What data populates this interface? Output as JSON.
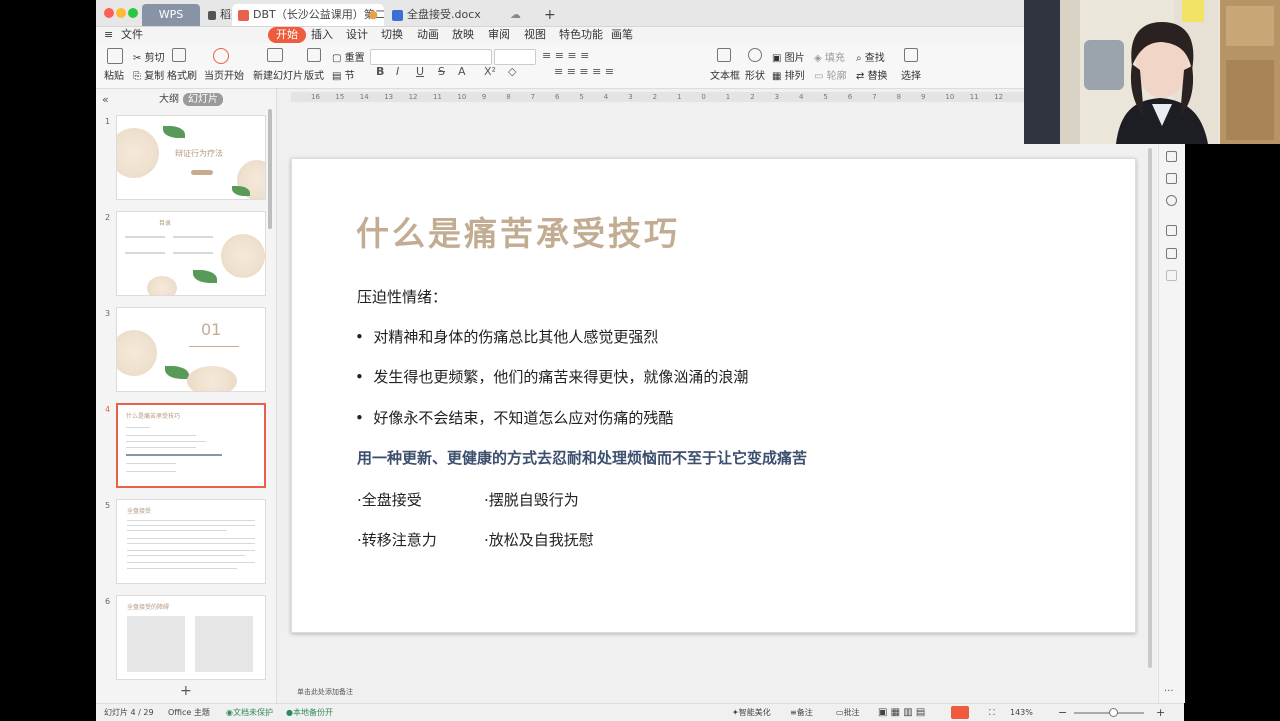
{
  "tabs": {
    "wps": "WPS",
    "daoke": "稻壳",
    "dbt": "DBT（长沙公益课用）第二课",
    "docx": "全盘接受.docx"
  },
  "menu": [
    "文件",
    "开始",
    "插入",
    "设计",
    "切换",
    "动画",
    "放映",
    "审阅",
    "视图",
    "特色功能",
    "画笔"
  ],
  "ribbon": {
    "paste": "粘贴",
    "cut": "剪切",
    "copy": "复制",
    "format_painter": "格式刷",
    "from_current": "当页开始",
    "new_slide": "新建幻灯片",
    "layout": "版式",
    "section": "节",
    "reset": "重置",
    "textbox": "文本框",
    "shape": "形状",
    "picture": "图片",
    "arrange": "排列",
    "fill": "填充",
    "outline": "轮廓",
    "find": "查找",
    "replace": "替换",
    "select": "选择"
  },
  "left_panel": {
    "outline_tab": "大纲",
    "slides_tab": "幻灯片",
    "thumbs": [
      {
        "num": "1",
        "title": "辩证行为疗法"
      },
      {
        "num": "2",
        "title": "目录"
      },
      {
        "num": "3",
        "title": "01"
      },
      {
        "num": "4",
        "title": "什么是痛苦承受技巧"
      },
      {
        "num": "5",
        "title": "全盘接受"
      },
      {
        "num": "6",
        "title": "全盘接受的障碍"
      }
    ],
    "add": "+"
  },
  "slide": {
    "title": "什么是痛苦承受技巧",
    "subtitle": "压迫性情绪：",
    "bullets": [
      "对精神和身体的伤痛总比其他人感觉更强烈",
      "发生得也更频繁，他们的痛苦来得更快，就像汹涌的浪潮",
      "好像永不会结束，不知道怎么应对伤痛的残酷"
    ],
    "highlight": "用一种更新、更健康的方式去忍耐和处理烦恼而不至于让它变成痛苦",
    "skills": [
      "·全盘接受",
      "·摆脱自毁行为",
      "·转移注意力",
      "·放松及自我抚慰"
    ]
  },
  "notes_placeholder": "单击此处添加备注",
  "ruler": [
    "16",
    "15",
    "14",
    "13",
    "12",
    "11",
    "10",
    "9",
    "8",
    "7",
    "6",
    "5",
    "4",
    "3",
    "2",
    "1",
    "0",
    "1",
    "2",
    "3",
    "4",
    "5",
    "6",
    "7",
    "8",
    "9",
    "10",
    "11",
    "12"
  ],
  "status": {
    "slide_counter": "幻灯片 4 / 29",
    "theme": "Office 主题",
    "doc_protect": "文档未保护",
    "backup": "本地备份开",
    "beautify": "智能美化",
    "notes": "备注",
    "comments": "批注",
    "zoom": "143%"
  }
}
